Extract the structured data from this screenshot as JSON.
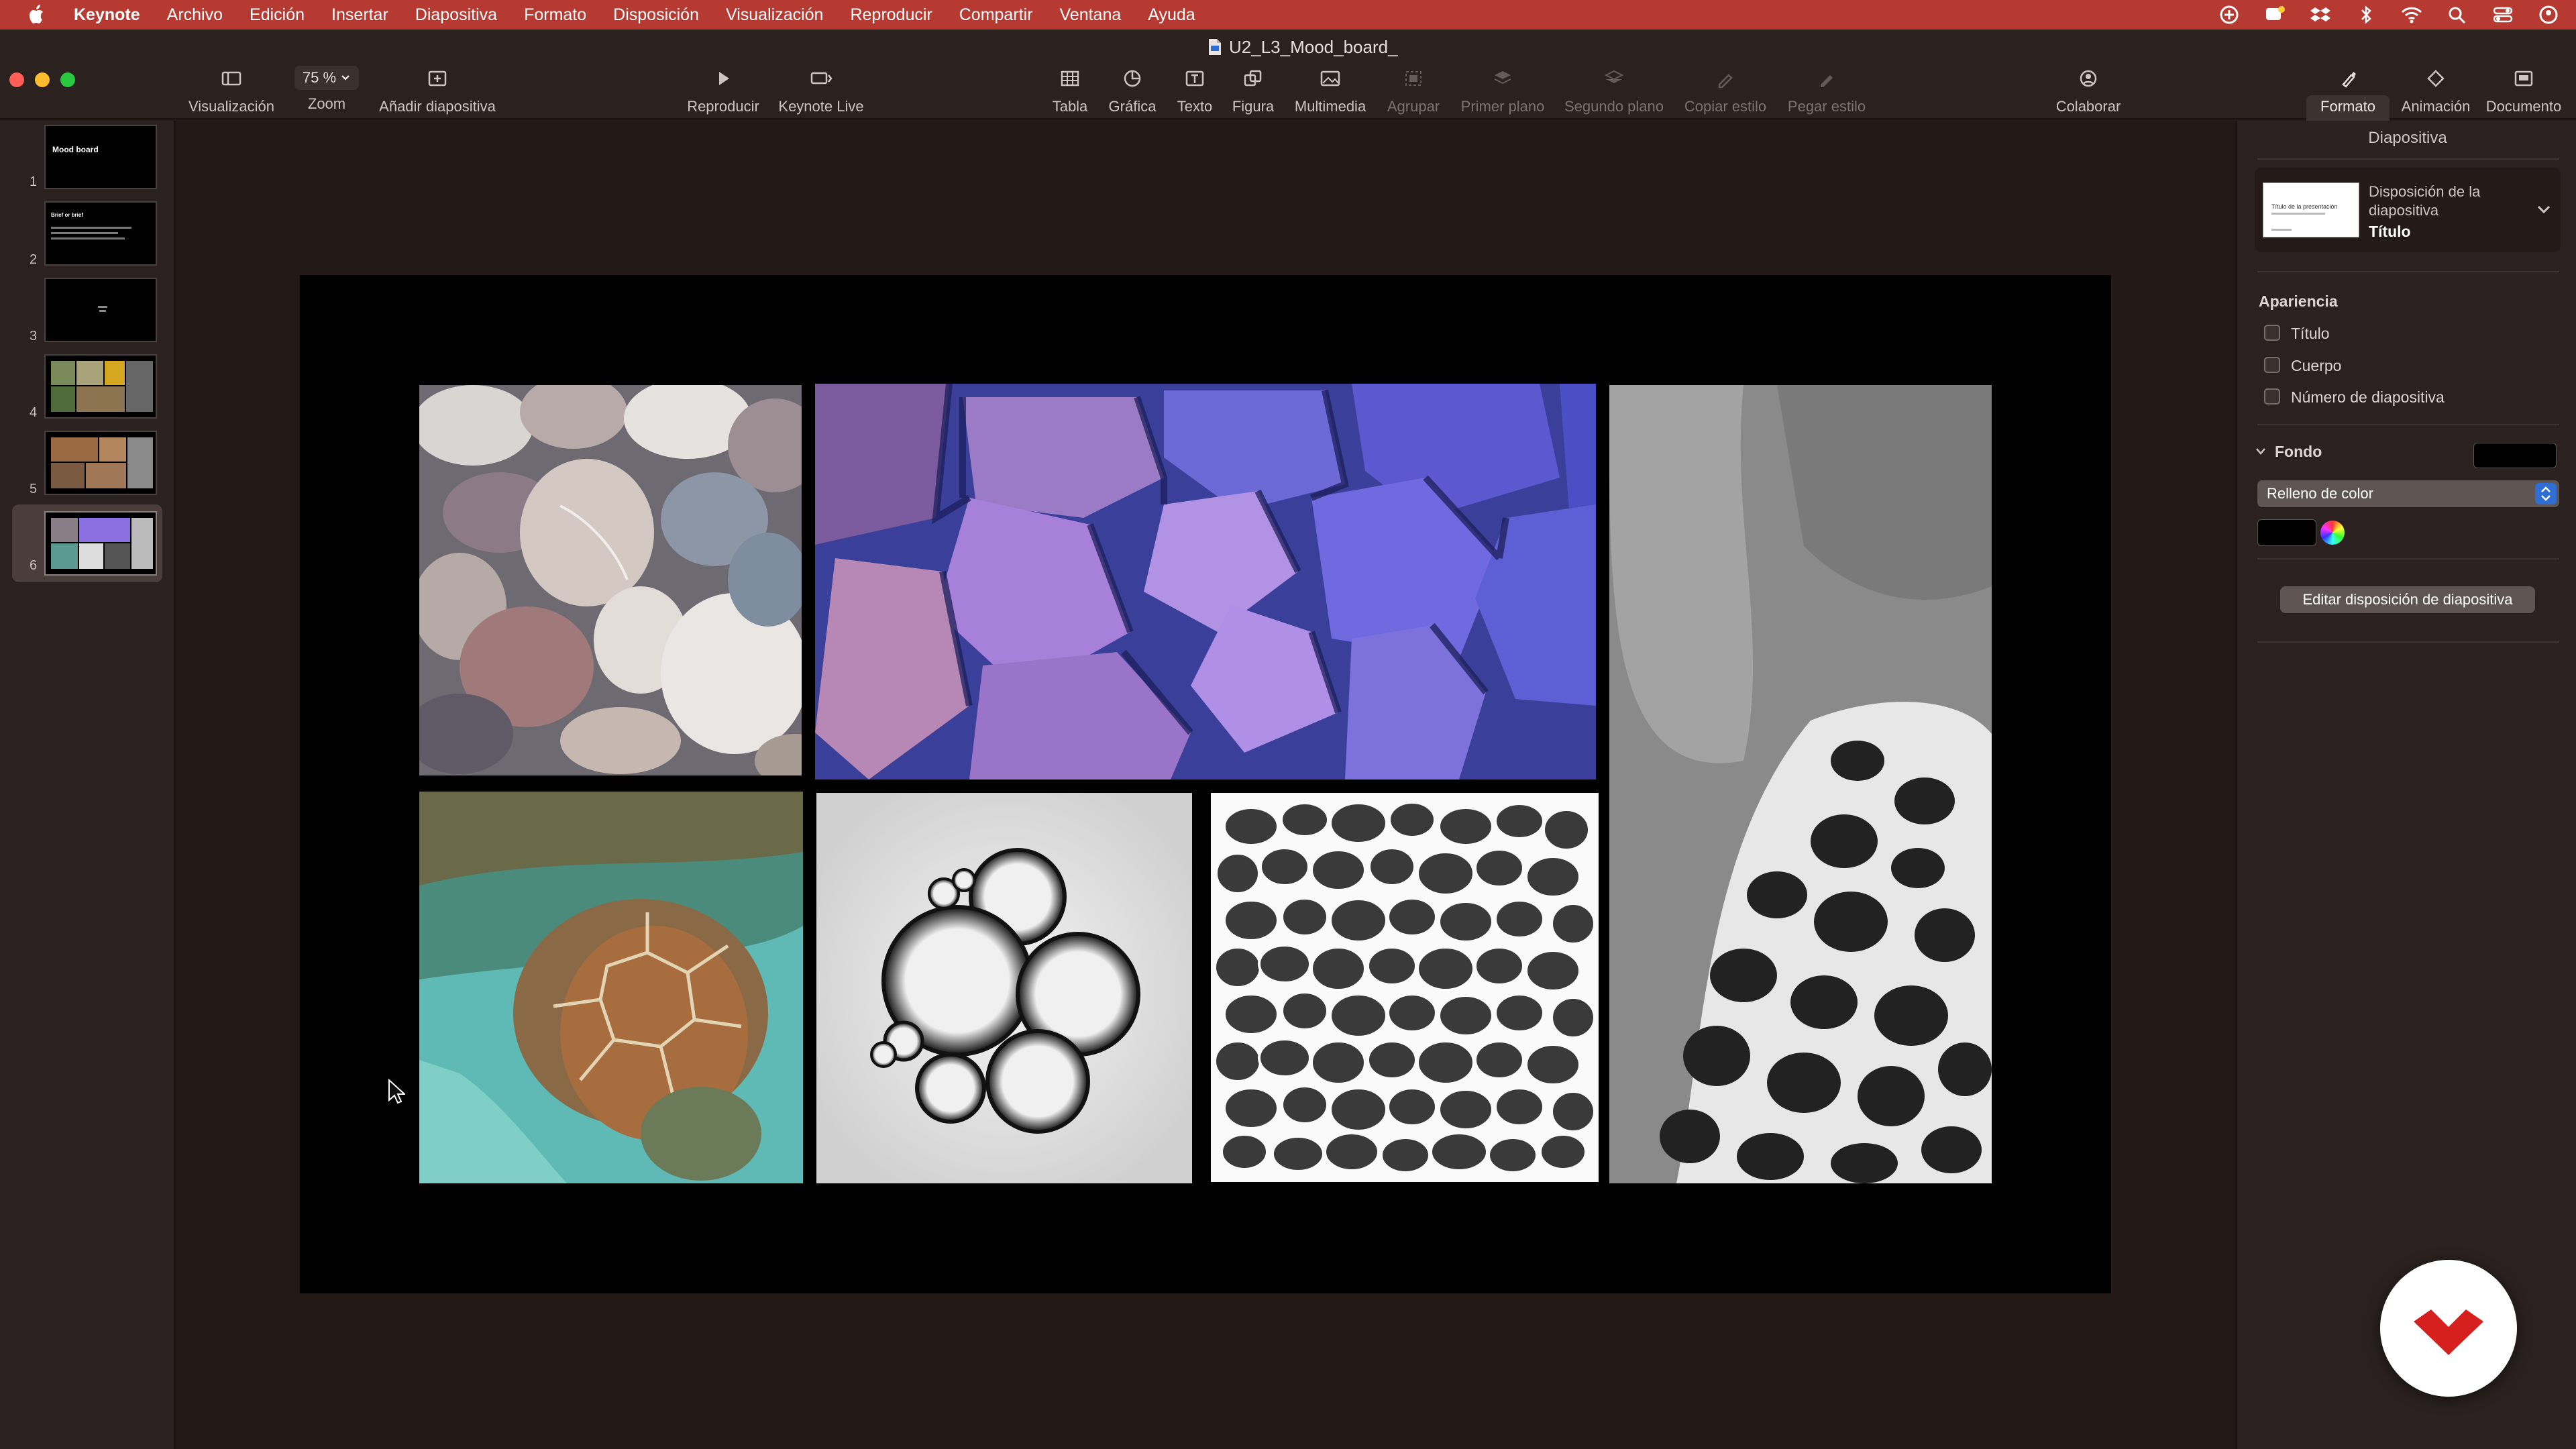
{
  "menubar": {
    "app": "Keynote",
    "items": [
      "Archivo",
      "Edición",
      "Insertar",
      "Diapositiva",
      "Formato",
      "Disposición",
      "Visualización",
      "Reproducir",
      "Compartir",
      "Ventana",
      "Ayuda"
    ]
  },
  "window": {
    "title": "U2_L3_Mood_board_"
  },
  "toolbar": {
    "zoom_value": "75 %",
    "buttons": {
      "view": "Visualización",
      "zoom": "Zoom",
      "add_slide": "Añadir diapositiva",
      "play": "Reproducir",
      "keynote_live": "Keynote Live",
      "table": "Tabla",
      "chart": "Gráfica",
      "text": "Texto",
      "shape": "Figura",
      "media": "Multimedia",
      "group": "Agrupar",
      "front": "Primer plano",
      "back": "Segundo plano",
      "copy_style": "Copiar estilo",
      "paste_style": "Pegar estilo",
      "collaborate": "Colaborar",
      "format": "Formato",
      "animate": "Animación",
      "document": "Documento"
    }
  },
  "slides": {
    "s1_title": "Mood board",
    "s2_title": "Brief or brief",
    "numbers": [
      "1",
      "2",
      "3",
      "4",
      "5",
      "6"
    ],
    "selected": 6
  },
  "inspector": {
    "title": "Diapositiva",
    "layout_label": "Disposición de la diapositiva",
    "layout_value": "Título",
    "layout_thumb_text": "Título de la presentación",
    "appearance_heading": "Apariencia",
    "checkboxes": [
      "Título",
      "Cuerpo",
      "Número de diapositiva"
    ],
    "background_heading": "Fondo",
    "fill_type": "Relleno de color",
    "fill_color": "#000000",
    "edit_layout_button": "Editar disposición de diapositiva"
  },
  "colors": {
    "menubar": "#b73a32",
    "window_bg": "#231a18",
    "accent_logo": "#d6201d"
  },
  "icons": [
    "apple-icon",
    "view-icon",
    "add-slide-icon",
    "play-icon",
    "keynote-live-icon",
    "table-icon",
    "chart-icon",
    "text-icon",
    "shape-icon",
    "media-icon",
    "group-icon",
    "front-icon",
    "back-icon",
    "copy-style-icon",
    "paste-style-icon",
    "collaborate-icon",
    "format-icon",
    "animate-icon",
    "document-icon",
    "cursor-icon"
  ]
}
